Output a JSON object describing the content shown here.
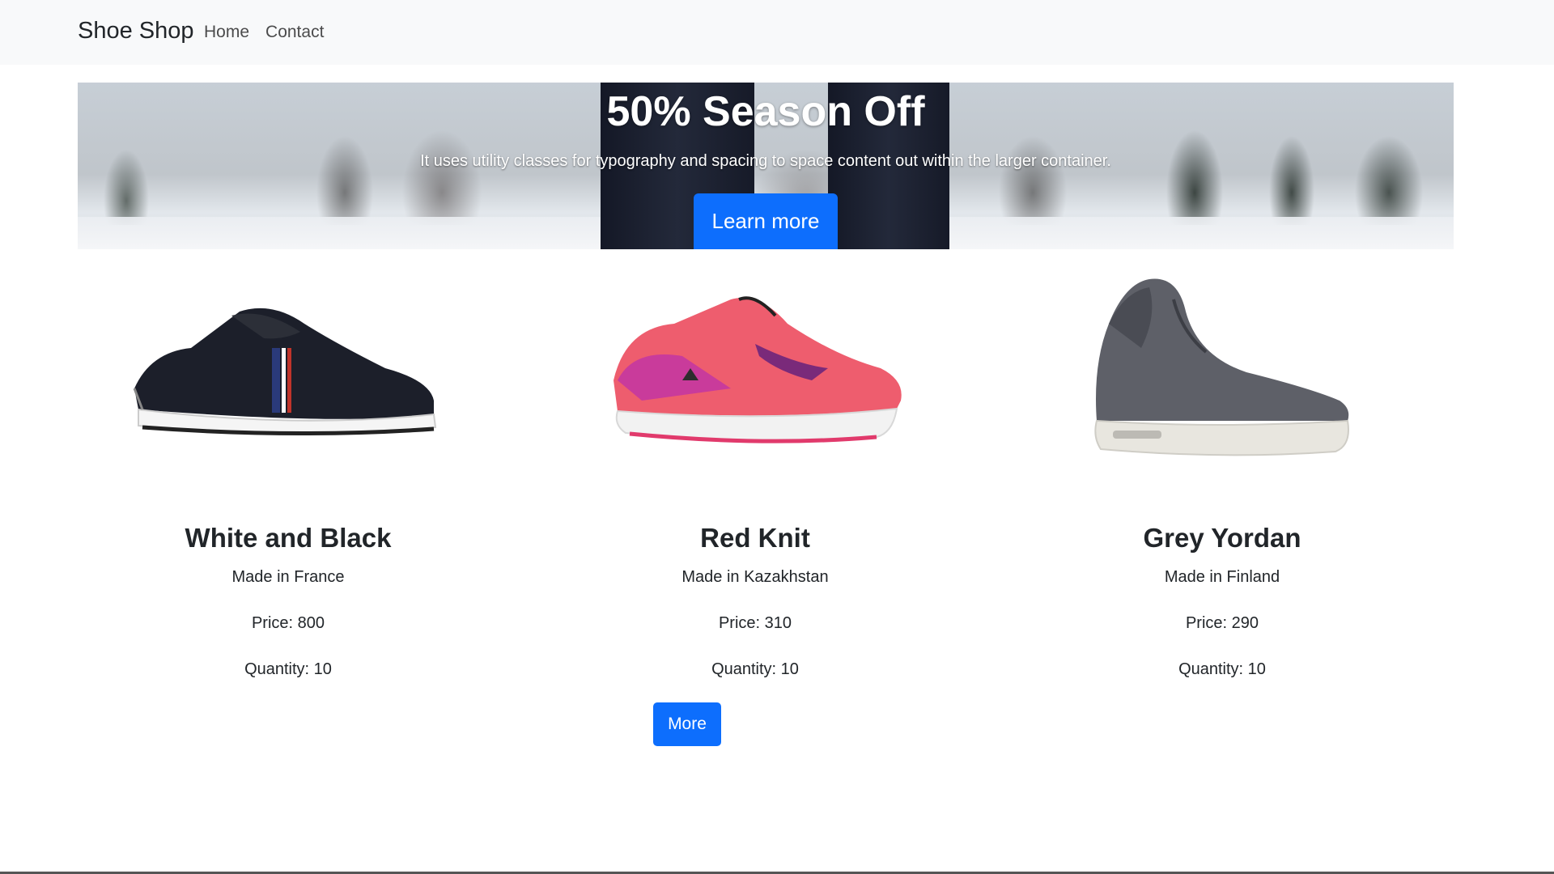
{
  "navbar": {
    "brand": "Shoe Shop",
    "links": [
      "Home",
      "Contact"
    ]
  },
  "hero": {
    "title": "50% Season Off",
    "text": "It uses utility classes for typography and spacing to space content out within the larger container.",
    "button_label": "Learn more"
  },
  "products": [
    {
      "name": "White and Black",
      "origin": "Made in France",
      "price": "Price: 800",
      "quantity": "Quantity: 10",
      "image": "black-sneaker"
    },
    {
      "name": "Red Knit",
      "origin": "Made in Kazakhstan",
      "price": "Price: 310",
      "quantity": "Quantity: 10",
      "image": "pink-running-shoe"
    },
    {
      "name": "Grey Yordan",
      "origin": "Made in Finland",
      "price": "Price: 290",
      "quantity": "Quantity: 10",
      "image": "grey-high-top"
    }
  ],
  "more_button": "More",
  "colors": {
    "primary": "#0d6efd",
    "navbar_bg": "#f8f9fa",
    "text": "#212529"
  }
}
